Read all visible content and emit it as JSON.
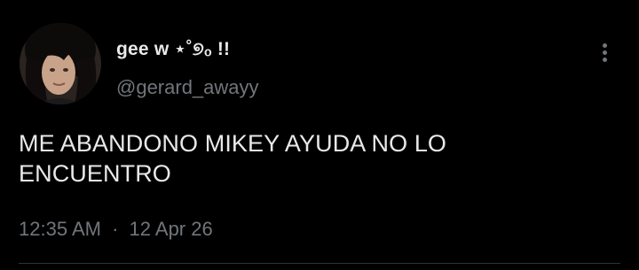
{
  "tweet": {
    "display_name": "gee w ⋆˚୭ₒ !!",
    "handle": "@gerard_awayy",
    "text": "ME ABANDONO MIKEY AYUDA NO LO ENCUENTRO",
    "time": "12:35 AM",
    "separator": "·",
    "date": "12 Apr 26"
  },
  "icons": {
    "more": "more-vertical-icon"
  },
  "colors": {
    "background": "#000000",
    "primary_text": "#e7e9ea",
    "secondary_text": "#71767b",
    "divider": "#2f3336"
  }
}
